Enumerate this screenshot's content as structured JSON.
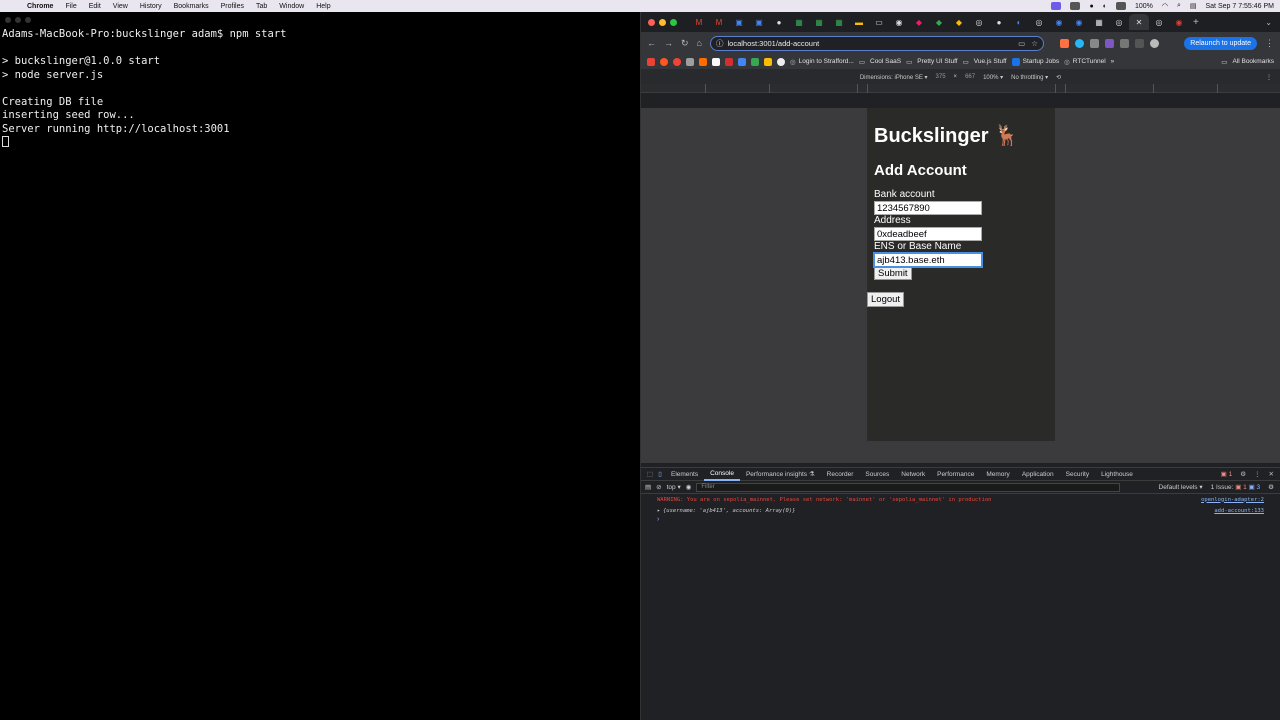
{
  "menubar": {
    "app": "Chrome",
    "items": [
      "File",
      "Edit",
      "View",
      "History",
      "Bookmarks",
      "Profiles",
      "Tab",
      "Window",
      "Help"
    ],
    "battery": "100%",
    "clock": "Sat Sep 7  7:55:46 PM"
  },
  "terminal": {
    "lines": [
      "Adams-MacBook-Pro:buckslinger adam$ npm start",
      "",
      "> buckslinger@1.0.0 start",
      "> node server.js",
      "",
      "Creating DB file",
      "inserting seed row...",
      "Server running http://localhost:3001"
    ]
  },
  "browser": {
    "url": "localhost:3001/add-account",
    "relaunch_label": "Relaunch to update",
    "bookmarks": [
      "Login to Strafford...",
      "Cool SaaS",
      "Pretty UI Stuff",
      "Vue.js Stuff",
      "Startup Jobs",
      "RTCTunnel"
    ],
    "all_bookmarks": "All Bookmarks",
    "device_toolbar": {
      "dimensions": "Dimensions: iPhone SE ▾",
      "width": "375",
      "x": "×",
      "height": "667",
      "zoom": "100% ▾",
      "throttle": "No throttling ▾"
    }
  },
  "page": {
    "brand": "Buckslinger 🦌",
    "heading": "Add Account",
    "fields": {
      "bank_label": "Bank account",
      "bank_value": "1234567890",
      "address_label": "Address",
      "address_value": "0xdeadbeef",
      "ens_label": "ENS or Base Name",
      "ens_value": "ajb413.base.eth"
    },
    "submit_label": "Submit",
    "logout_label": "Logout"
  },
  "devtools": {
    "tabs": [
      "Elements",
      "Console",
      "Performance insights ⚗",
      "Recorder",
      "Sources",
      "Network",
      "Performance",
      "Memory",
      "Application",
      "Security",
      "Lighthouse"
    ],
    "active_tab": "Console",
    "error_count": "1",
    "context": "top ▾",
    "filter_placeholder": "Filter",
    "levels": "Default levels ▾",
    "issues": "1 Issue:",
    "issues_err": "1",
    "issues_info": "3",
    "logs": [
      {
        "text": "WARNING: You are on sepolia_mainnet. Please set network: 'mainnet' or 'sepolia_mainnet' in production",
        "source": "openlogin-adapter:2"
      },
      {
        "text": "{username: 'ajb413', accounts: Array(0)}",
        "source": "add-account:133"
      }
    ],
    "prompt": "›"
  }
}
